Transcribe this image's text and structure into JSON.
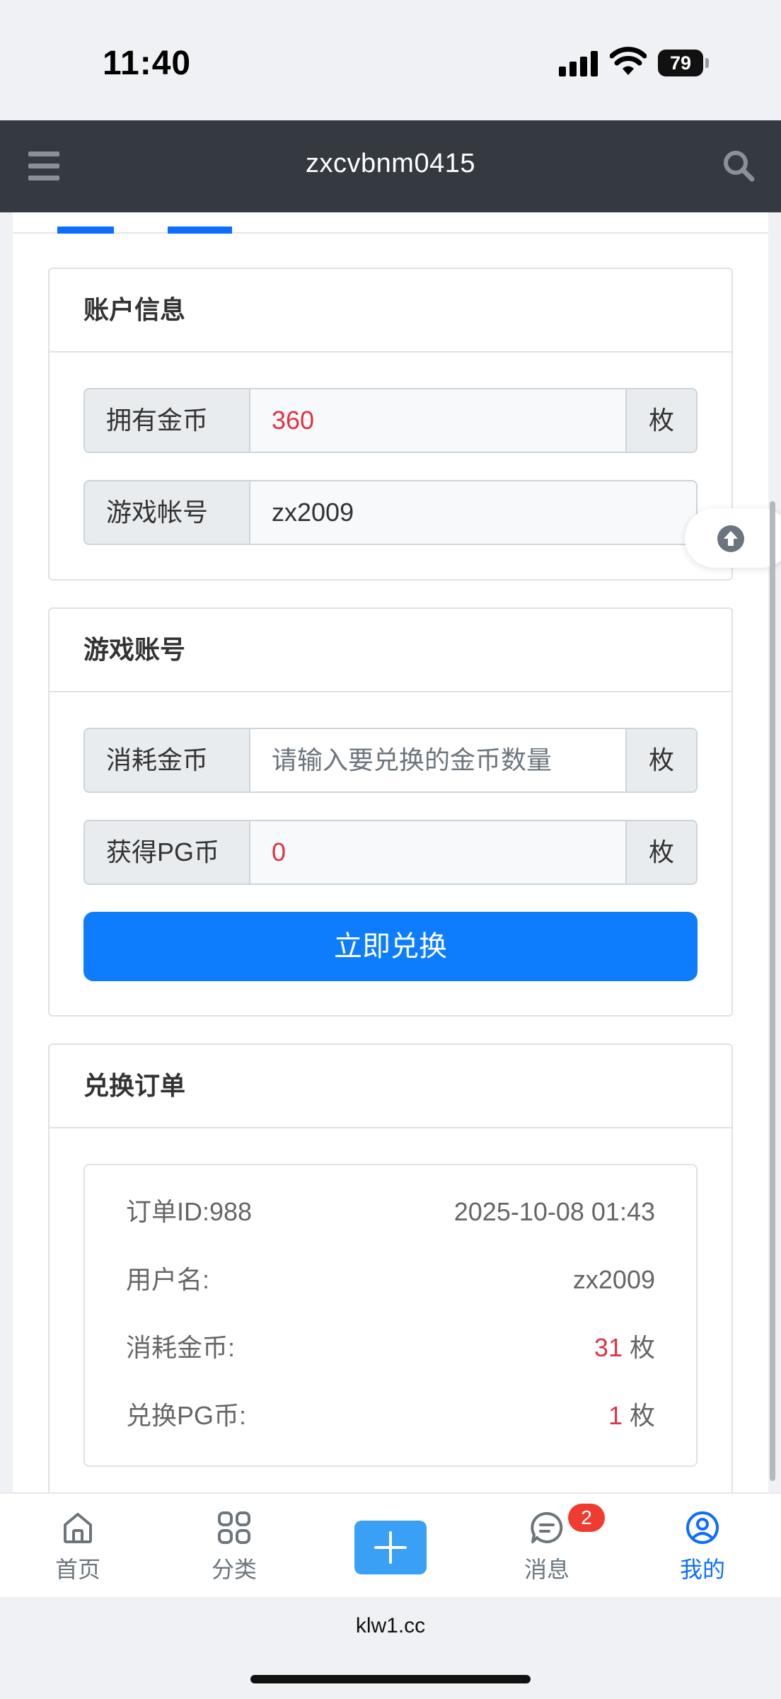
{
  "status_bar": {
    "time": "11:40",
    "battery": "79"
  },
  "header": {
    "title": "zxcvbnm0415"
  },
  "account_info": {
    "title": "账户信息",
    "coins_label": "拥有金币",
    "coins_value": "360",
    "coins_unit": "枚",
    "game_account_label": "游戏帐号",
    "game_account_value": "zx2009"
  },
  "game_account": {
    "title": "游戏账号",
    "consume_label": "消耗金币",
    "consume_placeholder": "请输入要兑换的金币数量",
    "consume_unit": "枚",
    "gain_label": "获得PG币",
    "gain_value": "0",
    "gain_unit": "枚",
    "exchange_button": "立即兑换"
  },
  "orders": {
    "title": "兑换订单",
    "items": [
      {
        "id_label": "订单ID:",
        "id_value": "988",
        "datetime": "2025-10-08 01:43",
        "username_label": "用户名:",
        "username_value": "zx2009",
        "consumed_label": "消耗金币:",
        "consumed_value": "31",
        "consumed_unit": "枚",
        "pg_label": "兑换PG币:",
        "pg_value": "1",
        "pg_unit": "枚"
      }
    ]
  },
  "bottom_nav": {
    "home": "首页",
    "category": "分类",
    "messages": "消息",
    "messages_badge": "2",
    "mine": "我的",
    "colors": {
      "active": "#0d6efd",
      "inactive": "#6c757d",
      "plus": "#3aa0f5"
    }
  },
  "browser": {
    "url": "klw1.cc"
  },
  "colors": {
    "header_bg": "#343a40",
    "primary": "#0d7dfd",
    "danger": "#dc3545"
  }
}
